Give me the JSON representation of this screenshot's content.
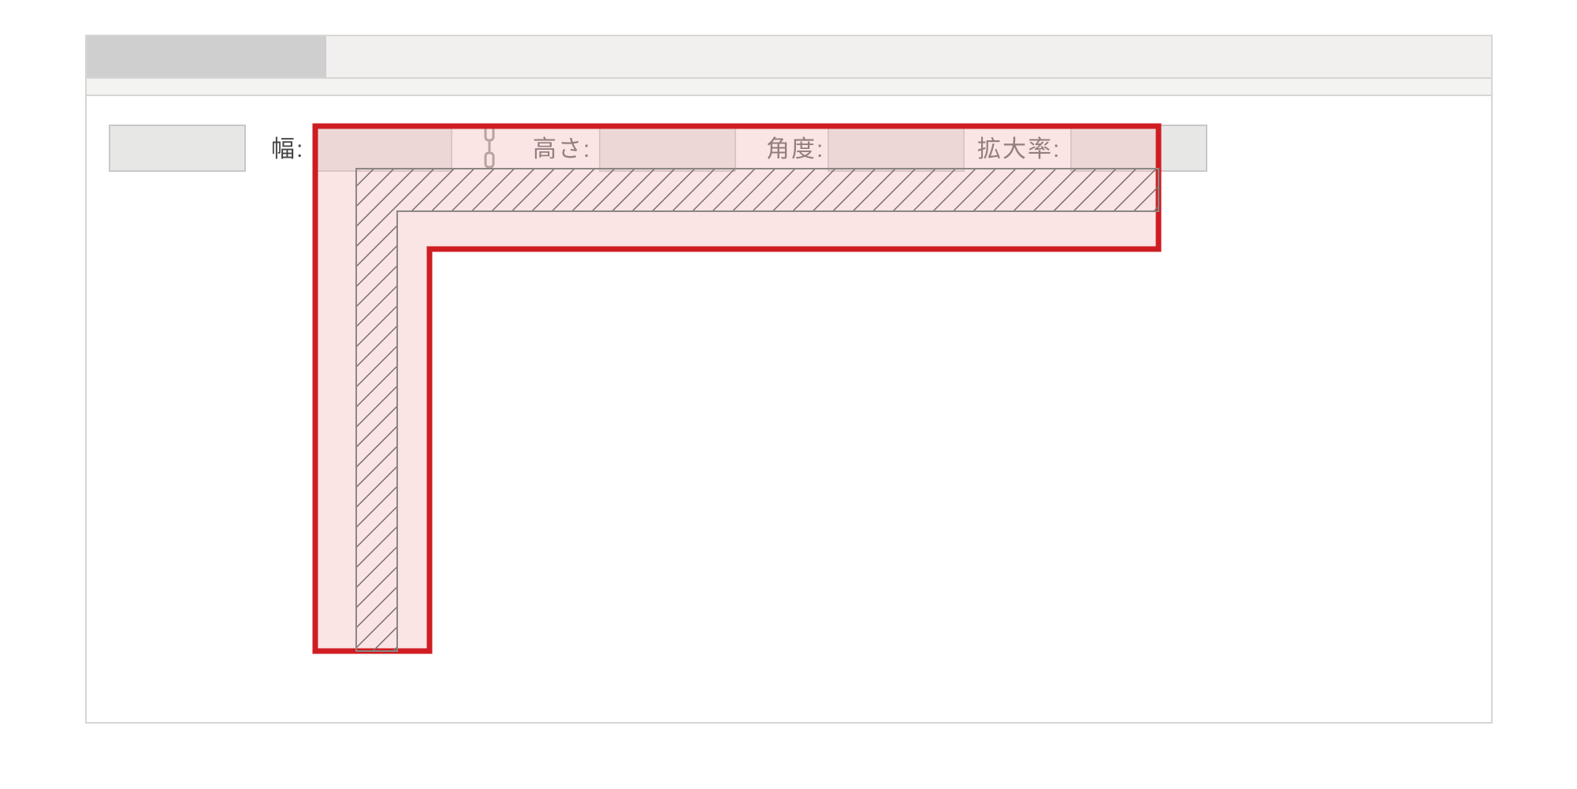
{
  "title_bar": {
    "tab_label": ""
  },
  "properties": {
    "width_label": "幅:",
    "height_label": "高さ:",
    "angle_label": "角度:",
    "zoom_label": "拡大率:",
    "width_value": "",
    "height_value": "",
    "angle_value": "",
    "zoom_value": ""
  },
  "annotation": {
    "highlight_color": "#cf1d22",
    "hatch_color": "#7b6f6f"
  }
}
